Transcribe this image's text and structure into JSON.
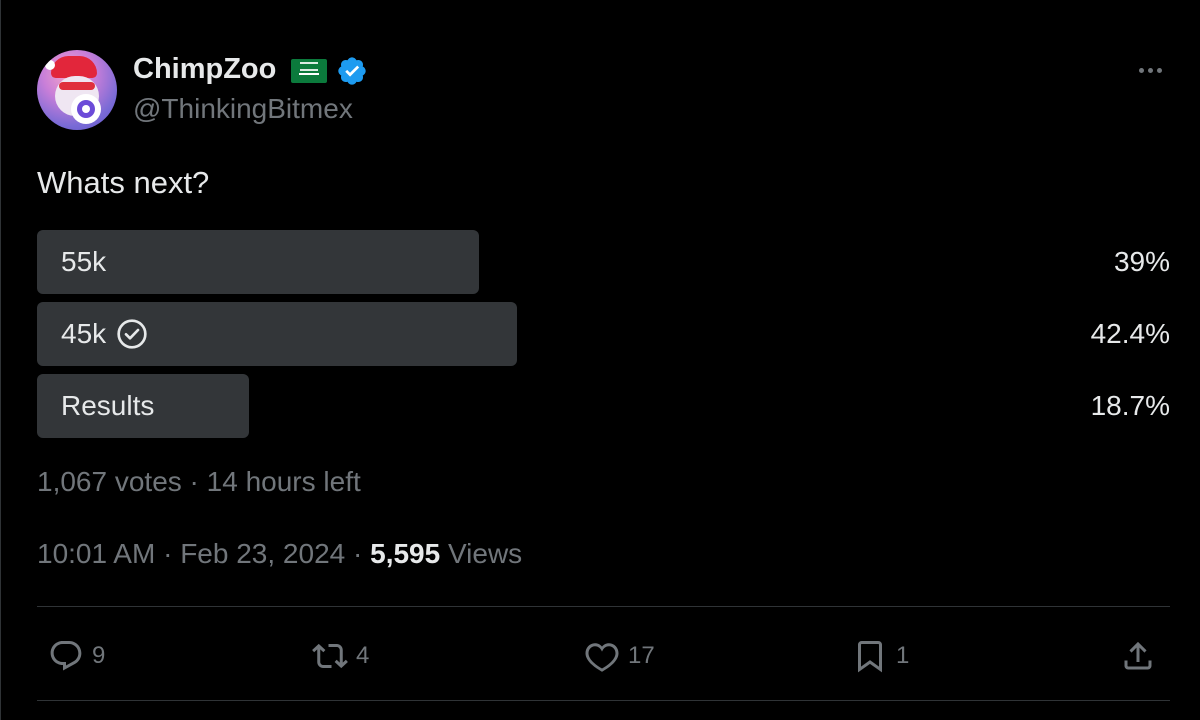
{
  "author": {
    "name": "ChimpZoo",
    "handle": "@ThinkingBitmex",
    "flag": "saudi-arabia-flag",
    "verified": true
  },
  "tweet": {
    "text": "Whats next?"
  },
  "poll": {
    "options": [
      {
        "label": "55k",
        "percent_label": "39%",
        "percent": 39,
        "winner": false
      },
      {
        "label": "45k",
        "percent_label": "42.4%",
        "percent": 42.4,
        "winner": true
      },
      {
        "label": "Results",
        "percent_label": "18.7%",
        "percent": 18.7,
        "winner": false
      }
    ],
    "meta": "1,067 votes · 14 hours left"
  },
  "meta": {
    "time": "10:01 AM",
    "sep1": " · ",
    "date": "Feb 23, 2024",
    "sep2": " · ",
    "views_count": "5,595",
    "views_label": " Views"
  },
  "actions": {
    "replies": "9",
    "reposts": "4",
    "likes": "17",
    "bookmarks": "1"
  },
  "colors": {
    "background": "#000000",
    "text": "#e7e9ea",
    "muted": "#71767b",
    "poll_bar": "#333639",
    "verified": "#1d9bf0"
  }
}
